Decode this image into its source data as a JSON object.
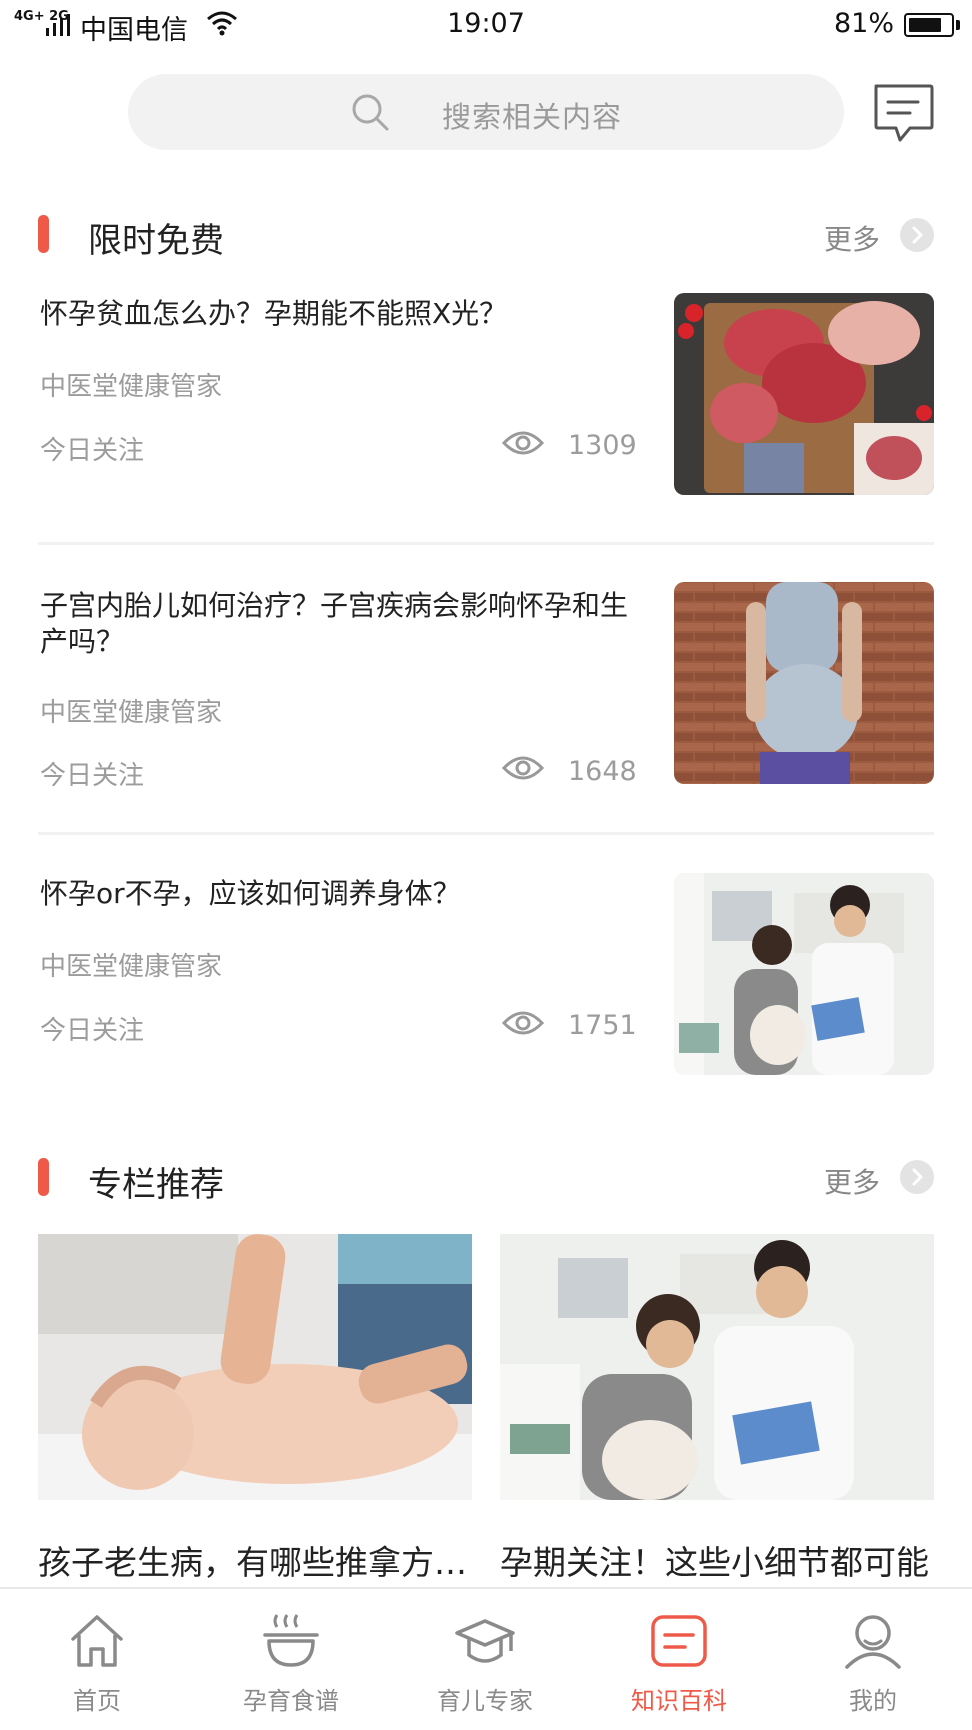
{
  "status_bar": {
    "network": "4G+ 2G",
    "carrier": "中国电信",
    "time": "19:07",
    "battery": "81%",
    "battery_level": 0.81
  },
  "search": {
    "placeholder": "搜索相关内容"
  },
  "icons": {
    "search": "search-icon",
    "message": "message-icon",
    "more": "chevron-right-icon",
    "views": "eye-icon"
  },
  "colors": {
    "accent": "#ef5a48",
    "muted": "#9c9c9c",
    "search_bg": "#f2f2f2"
  },
  "free_section": {
    "title": "限时免费",
    "more_label": "更多",
    "articles": [
      {
        "title": "怀孕贫血怎么办？孕期能不能照X光？",
        "source": "中医堂健康管家",
        "tag": "今日关注",
        "views": "1309",
        "image": "raw meat and steaks on cutting board"
      },
      {
        "title": "子宫内胎儿如何治疗？子宫疾病会影响怀孕和生产吗？",
        "source": "中医堂健康管家",
        "tag": "今日关注",
        "views": "1648",
        "image": "pregnant woman in front of brick wall"
      },
      {
        "title": "怀孕or不孕，应该如何调养身体？",
        "source": "中医堂健康管家",
        "tag": "今日关注",
        "views": "1751",
        "image": "pregnant woman with doctor holding clipboard"
      }
    ]
  },
  "column_section": {
    "title": "专栏推荐",
    "more_label": "更多",
    "cards": [
      {
        "title": "孩子老生病，有哪些推拿方法？",
        "image": "baby receiving massage"
      },
      {
        "title": "孕期关注！这些小细节都可能",
        "image": "pregnant woman with doctor"
      }
    ]
  },
  "bottom_nav": {
    "items": [
      {
        "label": "首页",
        "icon": "home-icon"
      },
      {
        "label": "孕育食谱",
        "icon": "bowl-icon"
      },
      {
        "label": "育儿专家",
        "icon": "graduation-cap-icon"
      },
      {
        "label": "知识百科",
        "icon": "document-icon",
        "active": true
      },
      {
        "label": "我的",
        "icon": "user-icon"
      }
    ]
  }
}
